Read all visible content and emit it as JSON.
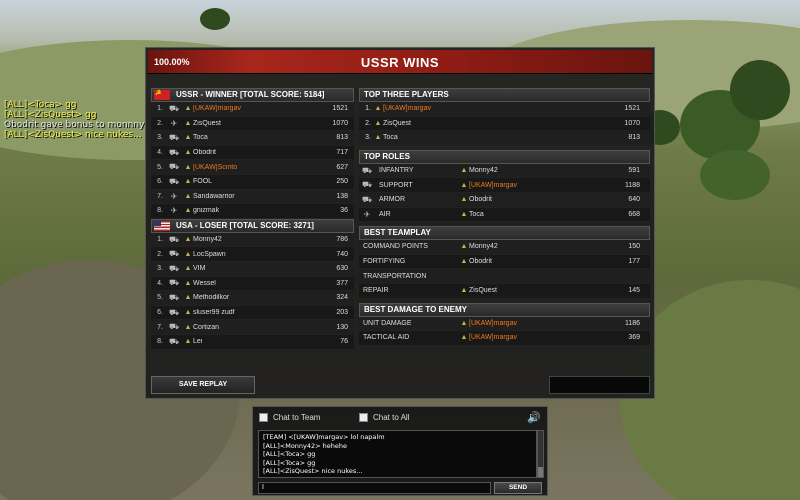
{
  "banner": {
    "percent": "100.00%",
    "title": "USSR WINS"
  },
  "ussr": {
    "header": "USSR - WINNER [TOTAL SCORE: 5184]",
    "players": [
      {
        "rank": "1.",
        "cls": "⛟",
        "name": "[UKAW]margav",
        "score": "1521",
        "hl": true
      },
      {
        "rank": "2.",
        "cls": "✈",
        "name": "ZisQuest",
        "score": "1070",
        "hl": false
      },
      {
        "rank": "3.",
        "cls": "⛟",
        "name": "Toca",
        "score": "813",
        "hl": false
      },
      {
        "rank": "4.",
        "cls": "⛟",
        "name": "Obodrit",
        "score": "717",
        "hl": false
      },
      {
        "rank": "5.",
        "cls": "⛟",
        "name": "[UKAW]Scinto",
        "score": "627",
        "hl": true
      },
      {
        "rank": "6.",
        "cls": "⛟",
        "name": "FOOL",
        "score": "250",
        "hl": false
      },
      {
        "rank": "7.",
        "cls": "✈",
        "name": "Sandawarrior",
        "score": "138",
        "hl": false
      },
      {
        "rank": "8.",
        "cls": "✈",
        "name": "gnizmak",
        "score": "36",
        "hl": false
      }
    ]
  },
  "usa": {
    "header": "USA - LOSER [TOTAL SCORE: 3271]",
    "players": [
      {
        "rank": "1.",
        "cls": "⛟",
        "name": "Monny42",
        "score": "786"
      },
      {
        "rank": "2.",
        "cls": "⛟",
        "name": "LocSpawn",
        "score": "740"
      },
      {
        "rank": "3.",
        "cls": "⛟",
        "name": "VIM",
        "score": "630"
      },
      {
        "rank": "4.",
        "cls": "⛟",
        "name": "Wessel",
        "score": "377"
      },
      {
        "rank": "5.",
        "cls": "⛟",
        "name": "Methodilkor",
        "score": "324"
      },
      {
        "rank": "6.",
        "cls": "⛟",
        "name": "sluser99 zudf",
        "score": "203"
      },
      {
        "rank": "7.",
        "cls": "⛟",
        "name": "Cortizan",
        "score": "130"
      },
      {
        "rank": "8.",
        "cls": "⛟",
        "name": "Lei",
        "score": "76"
      }
    ]
  },
  "top_three": {
    "header": "TOP THREE PLAYERS",
    "rows": [
      {
        "rank": "1.",
        "name": "[UKAW]margav",
        "score": "1521",
        "hl": true
      },
      {
        "rank": "2.",
        "name": "ZisQuest",
        "score": "1070",
        "hl": false
      },
      {
        "rank": "3.",
        "name": "Toca",
        "score": "813",
        "hl": false
      }
    ]
  },
  "top_roles": {
    "header": "TOP ROLES",
    "rows": [
      {
        "icon": "⛟",
        "label": "INFANTRY",
        "name": "Monny42",
        "score": "591",
        "hl": false
      },
      {
        "icon": "⛟",
        "label": "SUPPORT",
        "name": "[UKAW]margav",
        "score": "1188",
        "hl": true
      },
      {
        "icon": "⛟",
        "label": "ARMOR",
        "name": "Obodrit",
        "score": "640",
        "hl": false
      },
      {
        "icon": "✈",
        "label": "AIR",
        "name": "Toca",
        "score": "668",
        "hl": false
      }
    ]
  },
  "best_teamplay": {
    "header": "BEST TEAMPLAY",
    "rows": [
      {
        "label": "COMMAND POINTS",
        "name": "Monny42",
        "score": "150",
        "hl": false
      },
      {
        "label": "FORTIFYING",
        "name": "Obodrit",
        "score": "177",
        "hl": false
      },
      {
        "label": "TRANSPORTATION",
        "name": "",
        "score": "",
        "hl": false
      },
      {
        "label": "REPAIR",
        "name": "ZisQuest",
        "score": "145",
        "hl": false
      }
    ]
  },
  "best_damage": {
    "header": "BEST DAMAGE TO ENEMY",
    "rows": [
      {
        "label": "UNIT DAMAGE",
        "name": "[UKAW]margav",
        "score": "1186",
        "hl": true
      },
      {
        "label": "TACTICAL AID",
        "name": "[UKAW]margav",
        "score": "369",
        "hl": true
      }
    ]
  },
  "save_replay": "SAVE REPLAY",
  "chat": {
    "team_label": "Chat to Team",
    "all_label": "Chat to All",
    "messages": [
      "[TEAM] <[UKAW]margav> lol napalm",
      "[ALL]<Monny42> hehehe",
      "[ALL]<Toca> gg",
      "[ALL]<Toca> gg",
      "[ALL]<ZisQuest> nice nukes..."
    ],
    "input_value": "I",
    "send_label": "SEND"
  },
  "hud_chat": [
    {
      "text": "[ALL]<Toca> gg",
      "cls": ""
    },
    {
      "text": "[ALL]<ZisQuest> gg",
      "cls": ""
    },
    {
      "text": "Obodrit gave bonus to monnny",
      "cls": "w"
    },
    {
      "text": "[ALL]<ZisQuest> nice nukes...",
      "cls": ""
    }
  ]
}
